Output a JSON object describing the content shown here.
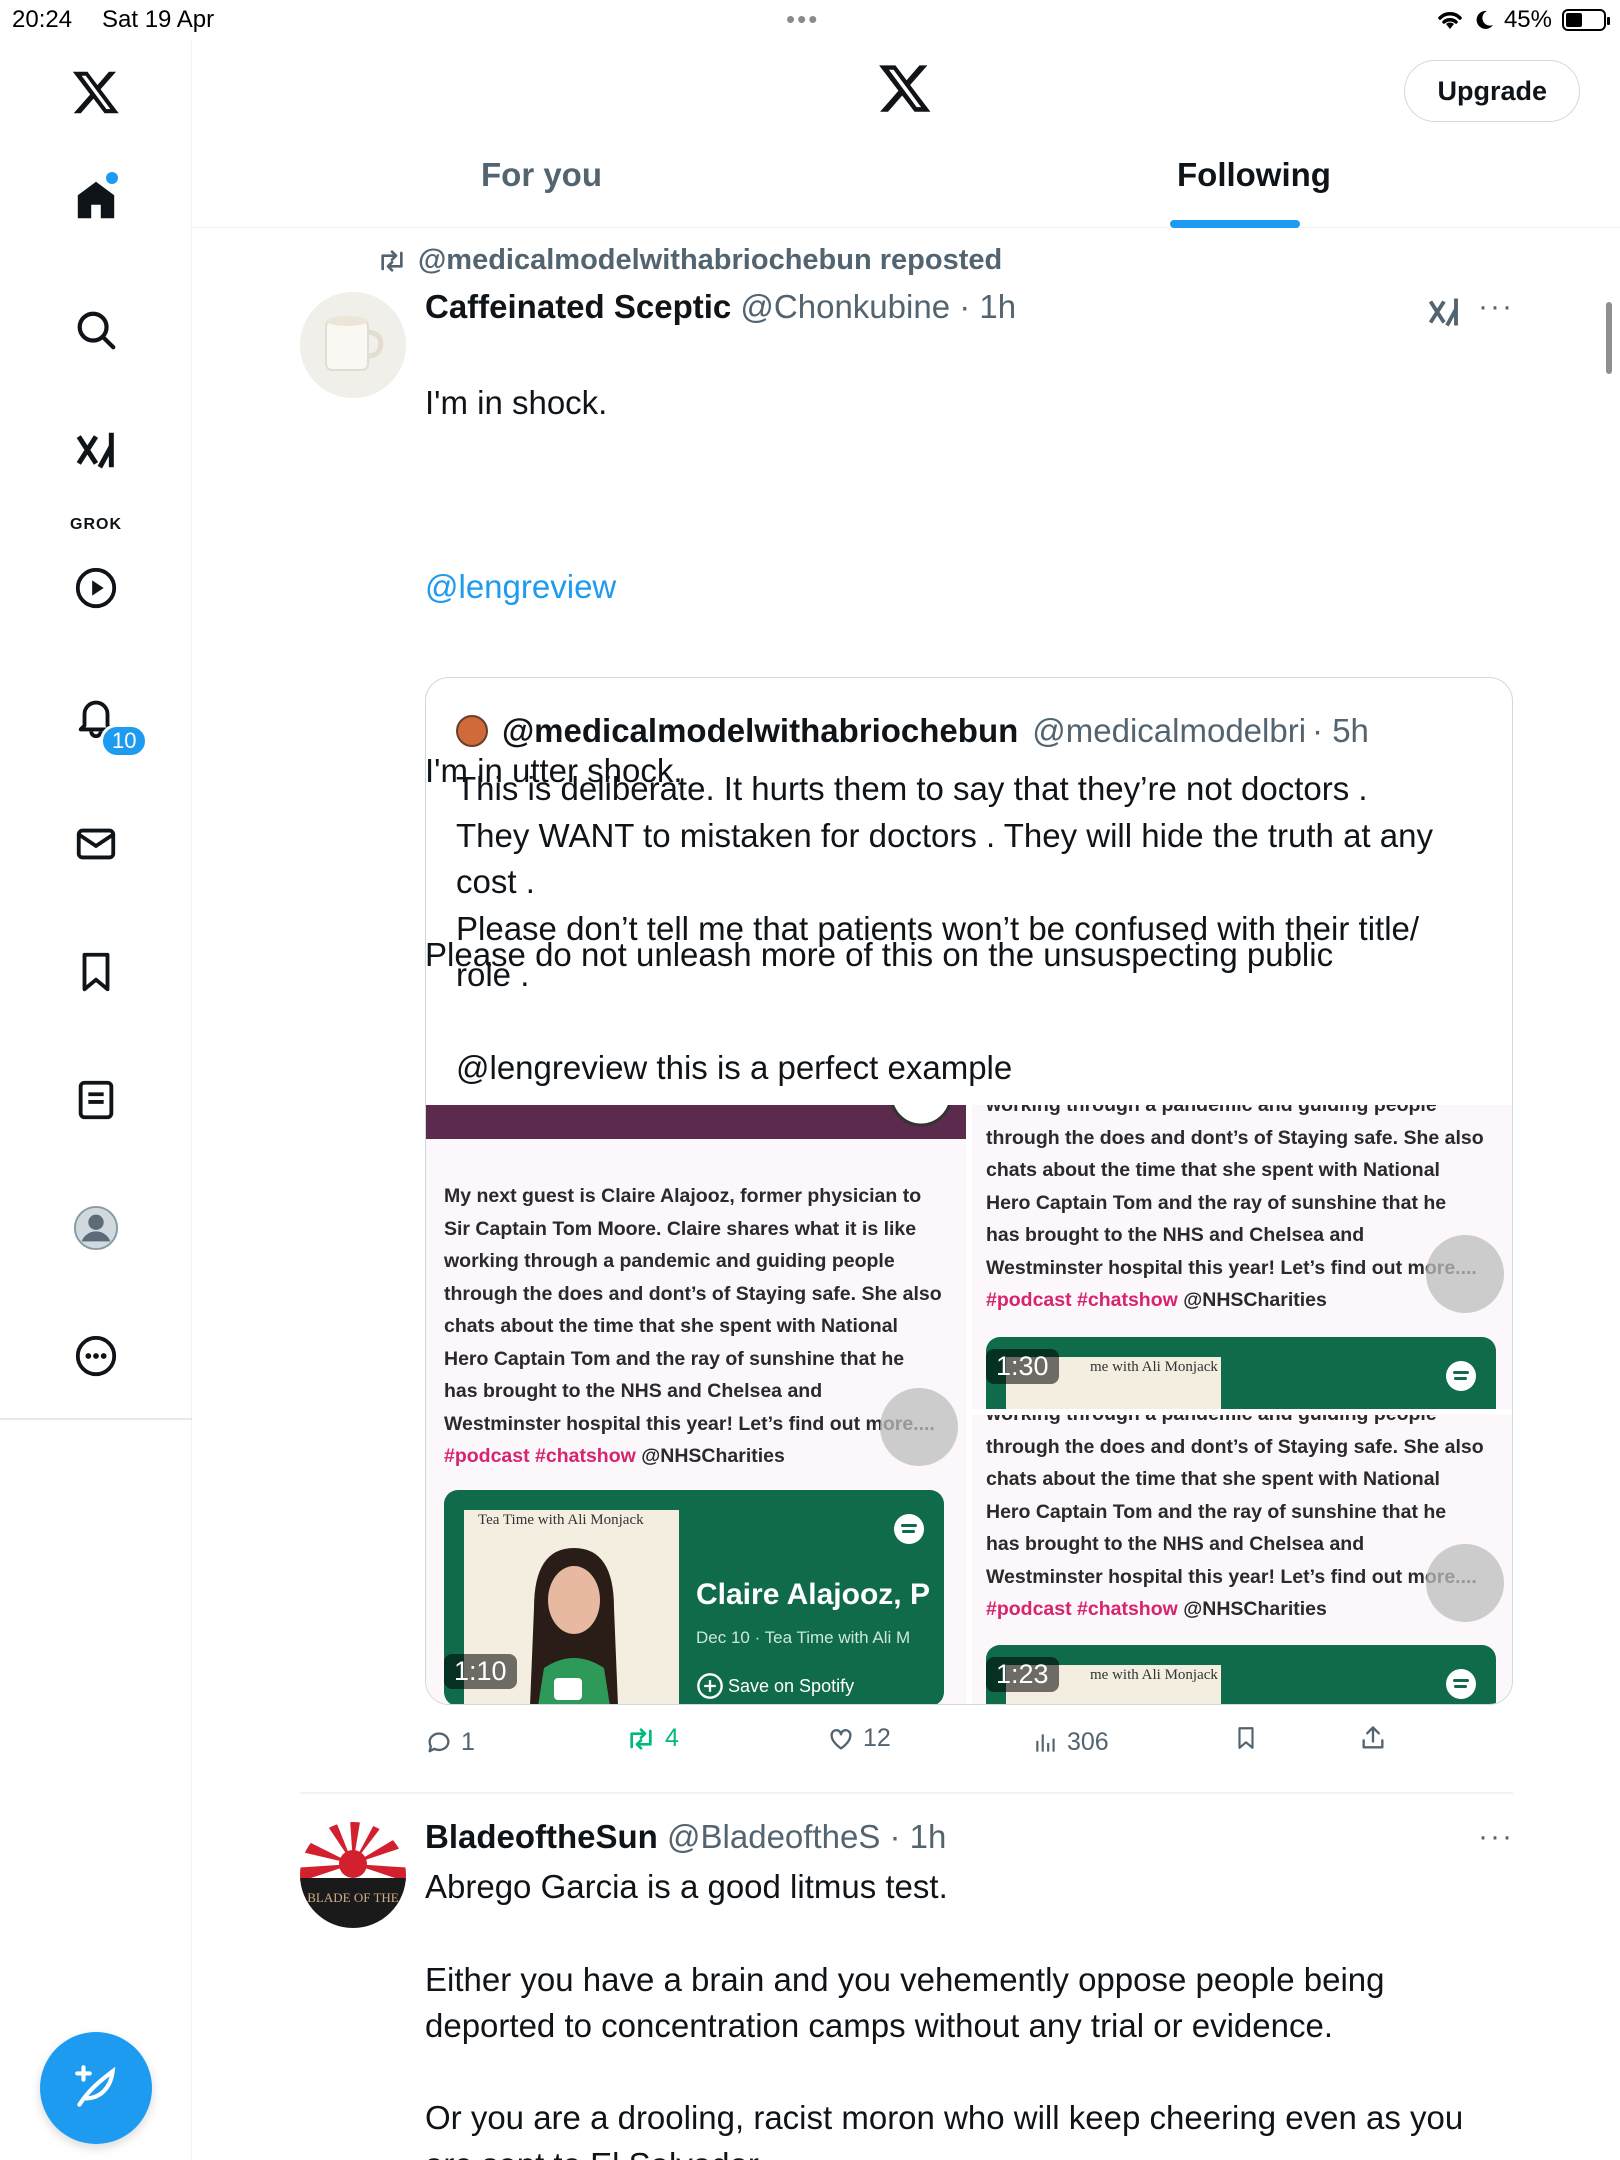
{
  "status_bar": {
    "time": "20:24",
    "date": "Sat 19 Apr",
    "battery": "45%",
    "battery_level": 0.45
  },
  "sidebar": {
    "grok_label": "GROK",
    "notifications_badge": "10",
    "items": [
      "home-icon",
      "search-icon",
      "grok-icon",
      "video-icon",
      "bell-icon",
      "mail-icon",
      "bookmark-icon",
      "lists-icon",
      "profile-icon",
      "more-icon"
    ]
  },
  "header": {
    "upgrade_label": "Upgrade",
    "tabs": [
      {
        "label": "For you",
        "active": false
      },
      {
        "label": "Following",
        "active": true
      }
    ]
  },
  "tweet1": {
    "repost_text": "@medicalmodelwithabriochebun reposted",
    "name": "Caffeinated Sceptic",
    "handle": "@Chonkubine",
    "time": "· 1h",
    "text_lines": [
      "I'm in shock.",
      "",
      "@lengreview",
      "",
      "I'm in utter shock.",
      "",
      "Please do not unleash more of this on the unsuspecting public"
    ],
    "quote": {
      "name": "@medicalmodelwithabriochebun",
      "handle": "@medicalmodelbri",
      "time": "· 5h",
      "text_lines": [
        "This is deliberate. It hurts them to say that they’re not doctors .",
        "They WANT to mistaken for doctors . They will hide the truth at any",
        "cost .",
        "Please don’t tell me that patients won’t be confused with their title/",
        "role .",
        "",
        "@lengreview this is a perfect example"
      ],
      "media": {
        "left_text_lines": [
          "My next guest is Claire Alajooz, former physician to",
          "Sir Captain Tom Moore. Claire shares what it is like",
          "working through a pandemic and guiding people",
          "through the does and dont’s of Staying safe. She also",
          "chats about the time that she spent with National",
          "Hero Captain Tom and the ray of sunshine that he",
          "has brought to the NHS and Chelsea and",
          "Westminster hospital this year! Let’s find out more...."
        ],
        "hashtags": "#podcast #chatshow",
        "mention": "@NHSCharities",
        "right_text_lines_top": [
          "working through a pandemic and guiding people",
          "through the does and dont’s of Staying safe. She also",
          "chats about the time that she spent with National",
          "Hero Captain Tom and the ray of sunshine that he",
          "has brought to the NHS and Chelsea and",
          "Westminster hospital this year! Let’s find out more...."
        ],
        "spotify_show": "Tea Time with Ali Monjack",
        "spotify_show_short": "me with Ali Monjack",
        "spotify_title": "Claire Alajooz, P",
        "spotify_sub": "Dec 10 · Tea Time with Ali M",
        "spotify_save": "Save on Spotify",
        "durations": [
          "1:10",
          "1:30",
          "1:23"
        ]
      }
    },
    "actions": {
      "replies": "1",
      "reposts": "4",
      "likes": "12",
      "views": "306"
    }
  },
  "tweet2": {
    "name": "BladeoftheSun",
    "handle": "@BladeoftheS",
    "time": "· 1h",
    "avatar_text": "BLADE OF THE",
    "text_lines": [
      "Abrego Garcia is a good litmus test.",
      "",
      "Either you have a brain and you vehemently oppose people being",
      "deported to concentration camps without any trial or evidence.",
      "",
      "Or you are a drooling, racist moron who will keep cheering even as you",
      "are sent to El Salvador."
    ]
  },
  "colors": {
    "accent": "#1d9bf0",
    "text_primary": "#0f1419",
    "text_secondary": "#536471",
    "repost_green": "#00ba7c",
    "spotify_green": "#0f6b4a",
    "hashtag_pink": "#d6246e"
  }
}
